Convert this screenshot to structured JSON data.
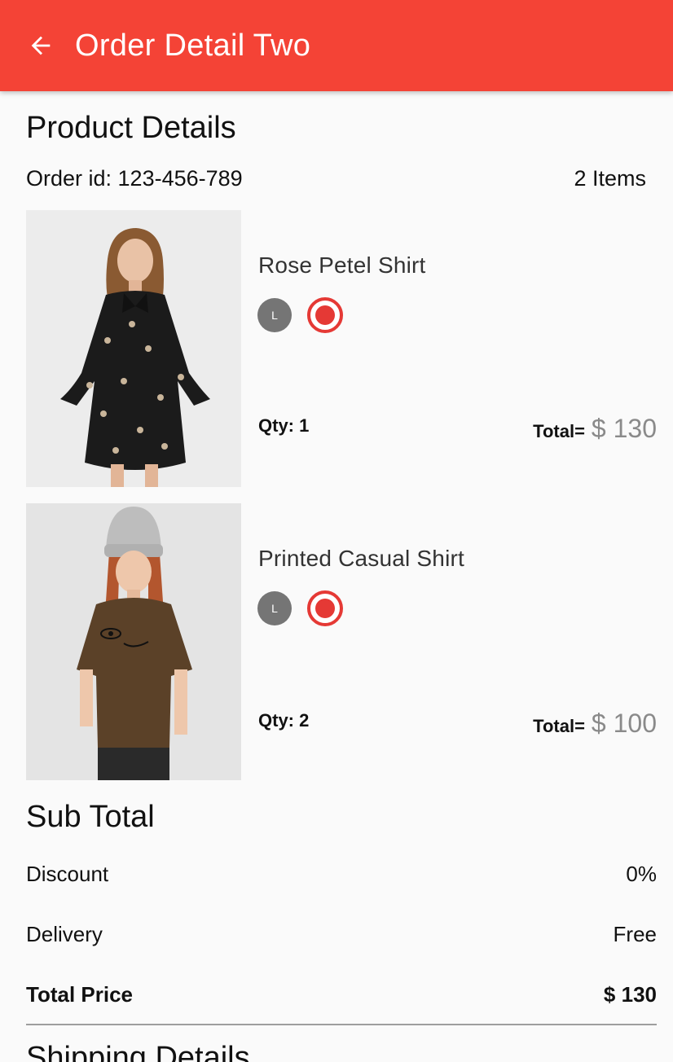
{
  "appbar": {
    "title": "Order Detail Two",
    "back_icon": "arrow-left-icon",
    "color": "#f44336"
  },
  "product_details": {
    "title": "Product Details",
    "order_id": "Order id: 123-456-789",
    "items_count": "2 Items"
  },
  "products": [
    {
      "name": "Rose Petel Shirt",
      "size": "L",
      "qty": "Qty: 1",
      "total_label": "Total=",
      "total_value": "$ 130",
      "color": "#e53935"
    },
    {
      "name": "Printed Casual Shirt",
      "size": "L",
      "qty": "Qty: 2",
      "total_label": "Total=",
      "total_value": "$ 100",
      "color": "#e53935"
    }
  ],
  "sub_total": {
    "title": "Sub Total",
    "rows": [
      {
        "label": "Discount",
        "value": "0%"
      },
      {
        "label": "Delivery",
        "value": "Free"
      },
      {
        "label": "Total Price",
        "value": "$ 130"
      }
    ]
  },
  "shipping": {
    "title": "Shipping Details"
  }
}
